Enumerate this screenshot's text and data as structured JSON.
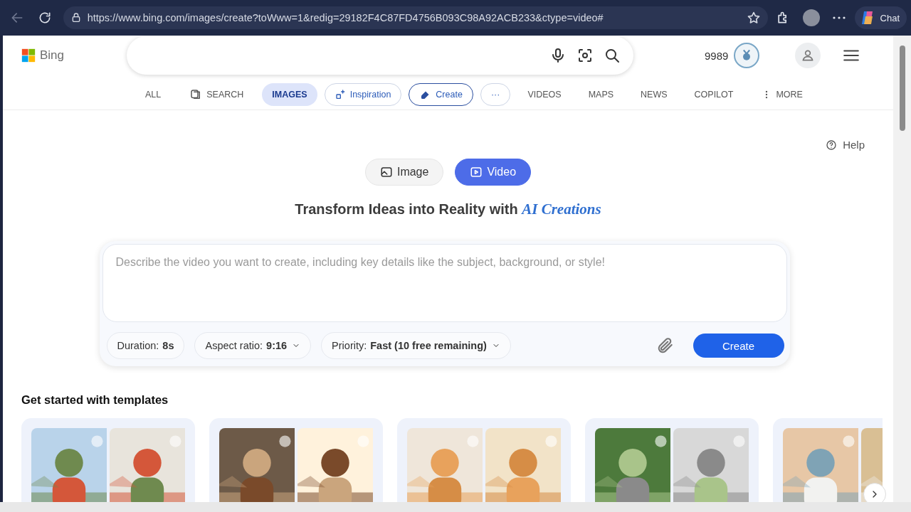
{
  "browser": {
    "url": "https://www.bing.com/images/create?toWww=1&redig=29182F4C87FD4756B093C98A92ACB233&ctype=video#",
    "chat_label": "Chat"
  },
  "header": {
    "logo": "Bing",
    "points": "9989"
  },
  "nav": [
    {
      "label": "ALL",
      "kind": "text",
      "selected": false
    },
    {
      "label": "SEARCH",
      "kind": "icon",
      "selected": false
    },
    {
      "label": "IMAGES",
      "kind": "text",
      "selected": true
    },
    {
      "label": "Inspiration",
      "kind": "pill",
      "selected": false
    },
    {
      "label": "Create",
      "kind": "pill",
      "selected": true
    },
    {
      "label": "···",
      "kind": "pill",
      "selected": false
    },
    {
      "label": "VIDEOS",
      "kind": "text",
      "selected": false
    },
    {
      "label": "MAPS",
      "kind": "text",
      "selected": false
    },
    {
      "label": "NEWS",
      "kind": "text",
      "selected": false
    },
    {
      "label": "COPILOT",
      "kind": "text",
      "selected": false
    },
    {
      "label": "MORE",
      "kind": "more",
      "selected": false
    }
  ],
  "help": "Help",
  "mode_tabs": [
    {
      "label": "Image",
      "selected": false
    },
    {
      "label": "Video",
      "selected": true
    }
  ],
  "headline": "Transform Ideas into Reality with *AI Creations*",
  "prompt": {
    "placeholder": "Describe the video you want to create, including key details like the subject, background, or style!"
  },
  "options": [
    {
      "label": "Duration:",
      "value": "8s",
      "dropdown": false
    },
    {
      "label": "Aspect ratio:",
      "value": "9:16",
      "dropdown": true
    },
    {
      "label": "Priority:",
      "value": "Fast (10 free remaining)",
      "dropdown": true
    }
  ],
  "create_button": "Create",
  "templates": {
    "title": "Get started with templates"
  }
}
